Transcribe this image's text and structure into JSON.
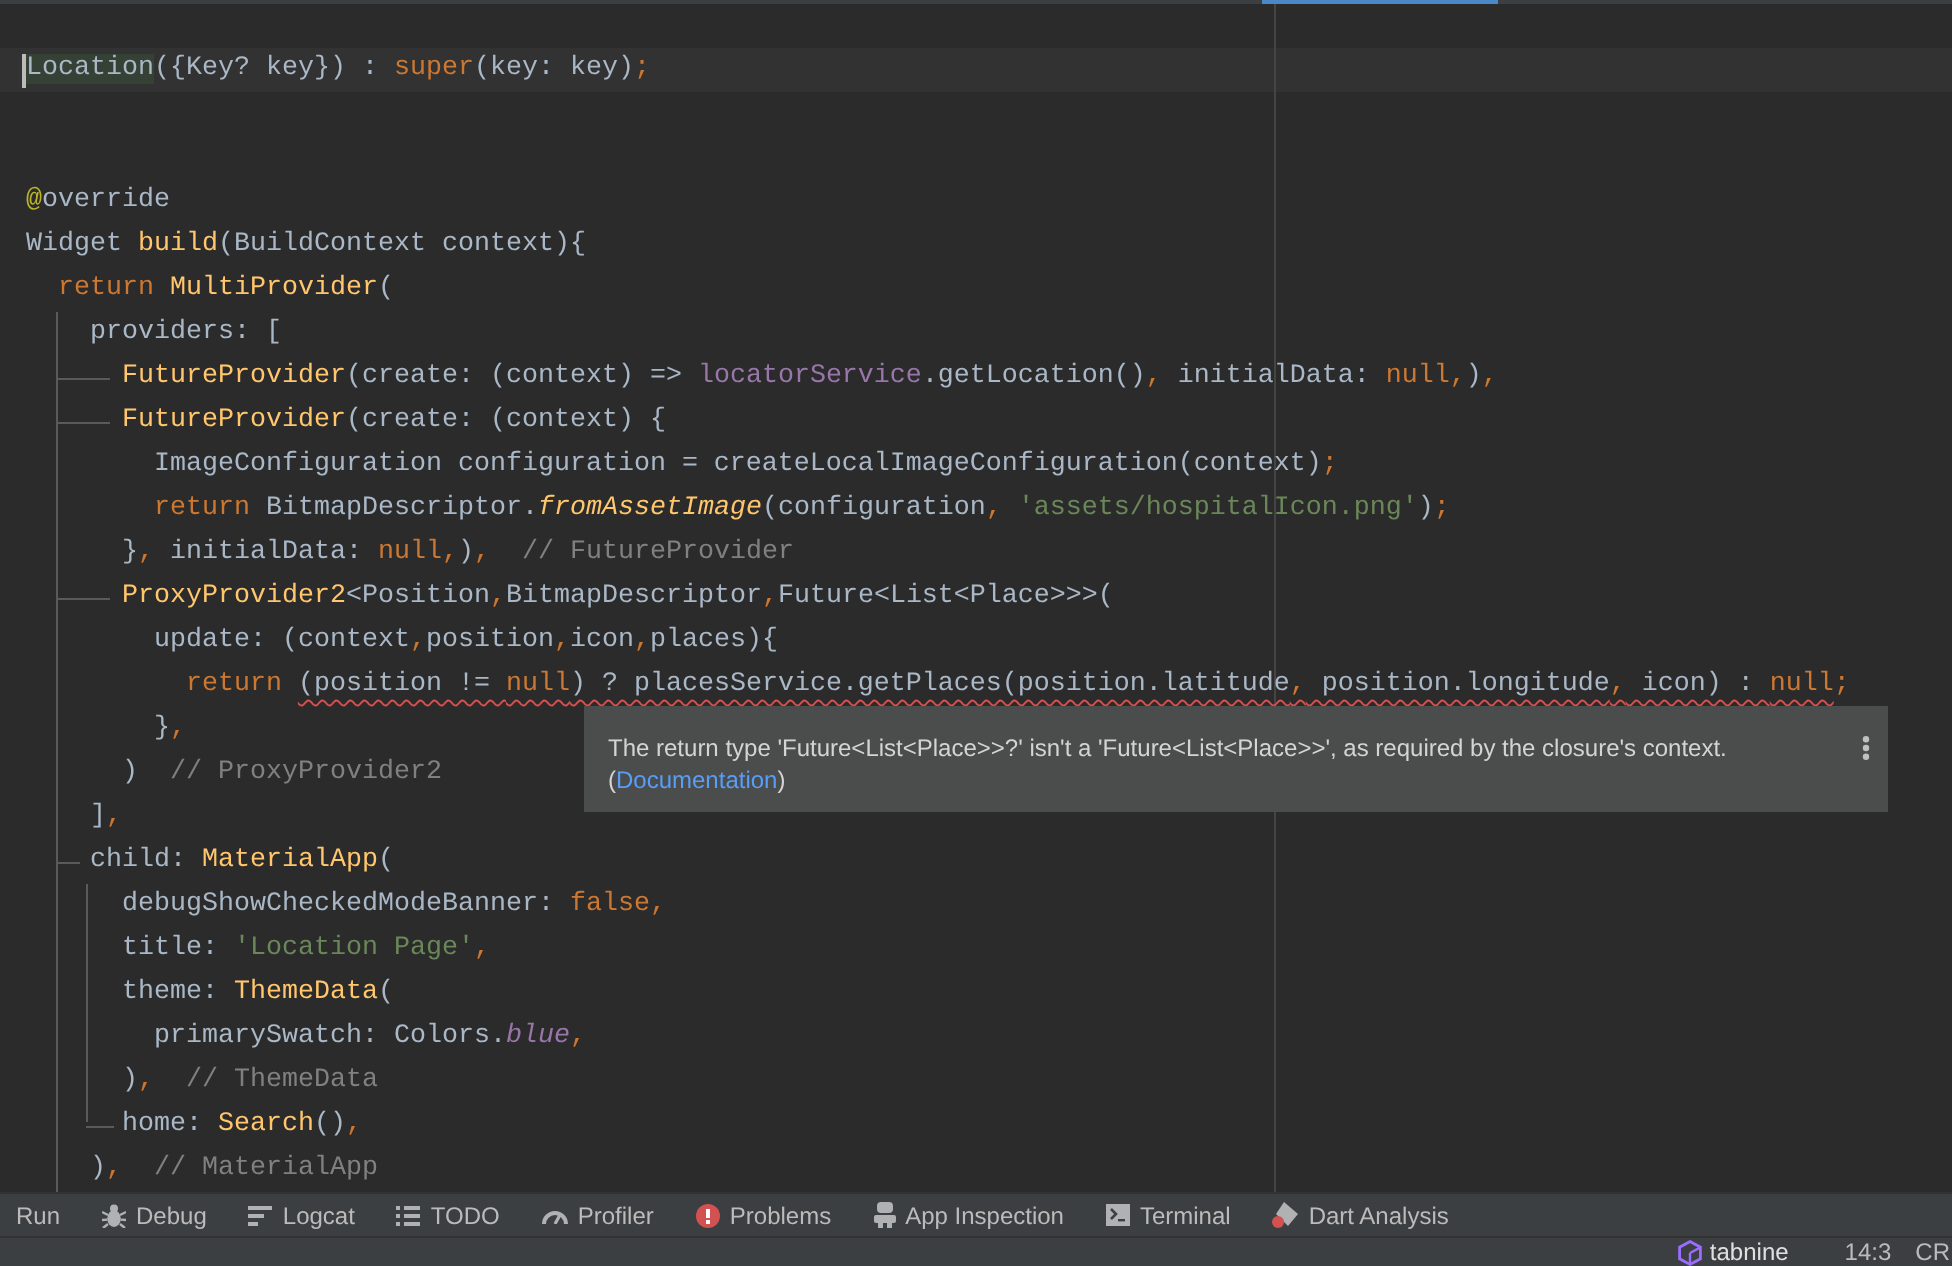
{
  "editor": {
    "lines": [
      {
        "kind": "code",
        "current": true,
        "tokens": [
          {
            "kind": "usage",
            "text": "Location"
          },
          {
            "kind": "plain",
            "text": "({Key? key}) : "
          },
          {
            "kind": "keyword",
            "text": "super"
          },
          {
            "kind": "plain",
            "text": "(key: key);"
          }
        ]
      },
      {
        "kind": "blank",
        "current": false
      },
      {
        "kind": "blank",
        "current": false
      },
      {
        "kind": "code",
        "current": false,
        "tokens": [
          {
            "kind": "annotation",
            "text": "@"
          },
          {
            "kind": "plain",
            "text": "override"
          }
        ]
      },
      {
        "kind": "code",
        "current": false,
        "tokens": [
          {
            "kind": "plain",
            "text": "Widget "
          },
          {
            "kind": "call",
            "text": "build"
          },
          {
            "kind": "plain",
            "text": "(BuildContext context){"
          }
        ]
      },
      {
        "kind": "code",
        "current": false,
        "tokens": [
          {
            "kind": "keyword",
            "text": "  return "
          },
          {
            "kind": "call",
            "text": "MultiProvider"
          },
          {
            "kind": "plain",
            "text": "("
          }
        ]
      },
      {
        "kind": "code",
        "current": false,
        "tokens": [
          {
            "kind": "plain",
            "text": "    providers: ["
          }
        ]
      },
      {
        "kind": "code",
        "current": false,
        "tokens": [
          {
            "kind": "call",
            "text": "      FutureProvider"
          },
          {
            "kind": "plain",
            "text": "(create: (context) => "
          },
          {
            "kind": "field",
            "text": "locatorService"
          },
          {
            "kind": "plain",
            "text": ".getLocation(), initialData: "
          },
          {
            "kind": "keyword",
            "text": "null"
          },
          {
            "kind": "plain",
            "text": ",),"
          }
        ]
      },
      {
        "kind": "code",
        "current": false,
        "tokens": [
          {
            "kind": "call",
            "text": "      FutureProvider"
          },
          {
            "kind": "plain",
            "text": "(create: (context) {"
          }
        ]
      },
      {
        "kind": "code",
        "current": false,
        "tokens": [
          {
            "kind": "plain",
            "text": "        ImageConfiguration configuration = createLocalImageConfiguration(context);"
          }
        ]
      },
      {
        "kind": "code",
        "current": false,
        "tokens": [
          {
            "kind": "keyword",
            "text": "        return"
          },
          {
            "kind": "plain",
            "text": " BitmapDescriptor."
          },
          {
            "kind": "method",
            "text": "fromAssetImage"
          },
          {
            "kind": "plain",
            "text": "(configuration, "
          },
          {
            "kind": "string",
            "text": "'assets/hospitalIcon.png'"
          },
          {
            "kind": "plain",
            "text": ");"
          }
        ]
      },
      {
        "kind": "code",
        "current": false,
        "tokens": [
          {
            "kind": "plain",
            "text": "      }, initialData: "
          },
          {
            "kind": "keyword",
            "text": "null"
          },
          {
            "kind": "plain",
            "text": ",),"
          },
          {
            "kind": "comment",
            "text": "  // FutureProvider"
          }
        ]
      },
      {
        "kind": "code",
        "current": false,
        "tokens": [
          {
            "kind": "call",
            "text": "      ProxyProvider2"
          },
          {
            "kind": "plain",
            "text": "<Position,BitmapDescriptor,Future<List<Place>>>("
          }
        ]
      },
      {
        "kind": "code",
        "current": false,
        "tokens": [
          {
            "kind": "plain",
            "text": "        update: (context,position,icon,places){"
          }
        ]
      },
      {
        "kind": "code",
        "current": false,
        "tokens": [
          {
            "kind": "keyword",
            "text": "          return "
          },
          {
            "kind": "error",
            "tokens": [
              {
                "kind": "plain",
                "text": "(position != "
              },
              {
                "kind": "keyword",
                "text": "null"
              },
              {
                "kind": "plain",
                "text": ") ? placesService.getPlaces(position.latitude, position.longitude, icon) : "
              },
              {
                "kind": "keyword",
                "text": "null"
              }
            ]
          },
          {
            "kind": "plain",
            "text": ";"
          }
        ]
      },
      {
        "kind": "code",
        "current": false,
        "tokens": [
          {
            "kind": "plain",
            "text": "        },"
          }
        ]
      },
      {
        "kind": "code",
        "current": false,
        "tokens": [
          {
            "kind": "plain",
            "text": "      )"
          },
          {
            "kind": "comment",
            "text": "  // ProxyProvider2"
          }
        ]
      },
      {
        "kind": "code",
        "current": false,
        "tokens": [
          {
            "kind": "plain",
            "text": "    ],"
          }
        ]
      },
      {
        "kind": "code",
        "current": false,
        "tokens": [
          {
            "kind": "plain",
            "text": "    child: "
          },
          {
            "kind": "call",
            "text": "MaterialApp"
          },
          {
            "kind": "plain",
            "text": "("
          }
        ]
      },
      {
        "kind": "code",
        "current": false,
        "tokens": [
          {
            "kind": "plain",
            "text": "      debugShowCheckedModeBanner: "
          },
          {
            "kind": "keyword",
            "text": "false"
          },
          {
            "kind": "plain",
            "text": ","
          }
        ]
      },
      {
        "kind": "code",
        "current": false,
        "tokens": [
          {
            "kind": "plain",
            "text": "      title: "
          },
          {
            "kind": "string",
            "text": "'Location Page'"
          },
          {
            "kind": "plain",
            "text": ","
          }
        ]
      },
      {
        "kind": "code",
        "current": false,
        "tokens": [
          {
            "kind": "plain",
            "text": "      theme: "
          },
          {
            "kind": "call",
            "text": "ThemeData"
          },
          {
            "kind": "plain",
            "text": "("
          }
        ]
      },
      {
        "kind": "code",
        "current": false,
        "tokens": [
          {
            "kind": "plain",
            "text": "        primarySwatch: Colors."
          },
          {
            "kind": "constant",
            "text": "blue"
          },
          {
            "kind": "plain",
            "text": ","
          }
        ]
      },
      {
        "kind": "code",
        "current": false,
        "tokens": [
          {
            "kind": "plain",
            "text": "      ),"
          },
          {
            "kind": "comment",
            "text": "  // ThemeData"
          }
        ]
      },
      {
        "kind": "code",
        "current": false,
        "tokens": [
          {
            "kind": "plain",
            "text": "      home: "
          },
          {
            "kind": "call",
            "text": "Search"
          },
          {
            "kind": "plain",
            "text": "(),"
          }
        ]
      },
      {
        "kind": "code",
        "current": false,
        "tokens": [
          {
            "kind": "plain",
            "text": "    ),"
          },
          {
            "kind": "comment",
            "text": "  // MaterialApp"
          }
        ]
      }
    ],
    "tooltip": {
      "message": "The return type 'Future<List<Place>>?' isn't a 'Future<List<Place>>', as required by the closure's context.",
      "link": {
        "before": "(",
        "label": "Documentation",
        "after": ")"
      }
    }
  },
  "tool_windows": [
    {
      "kind": "run",
      "label": "Run"
    },
    {
      "kind": "debug",
      "label": "Debug"
    },
    {
      "kind": "logcat",
      "label": "Logcat"
    },
    {
      "kind": "todo",
      "label": "TODO"
    },
    {
      "kind": "profiler",
      "label": "Profiler"
    },
    {
      "kind": "problems",
      "label": "Problems"
    },
    {
      "kind": "inspection",
      "label": "App Inspection"
    },
    {
      "kind": "terminal",
      "label": "Terminal"
    },
    {
      "kind": "analysis",
      "label": "Dart Analysis"
    }
  ],
  "status_bar": {
    "plugin": "tabnine",
    "position": "14:3",
    "line_separator": "CR"
  }
}
